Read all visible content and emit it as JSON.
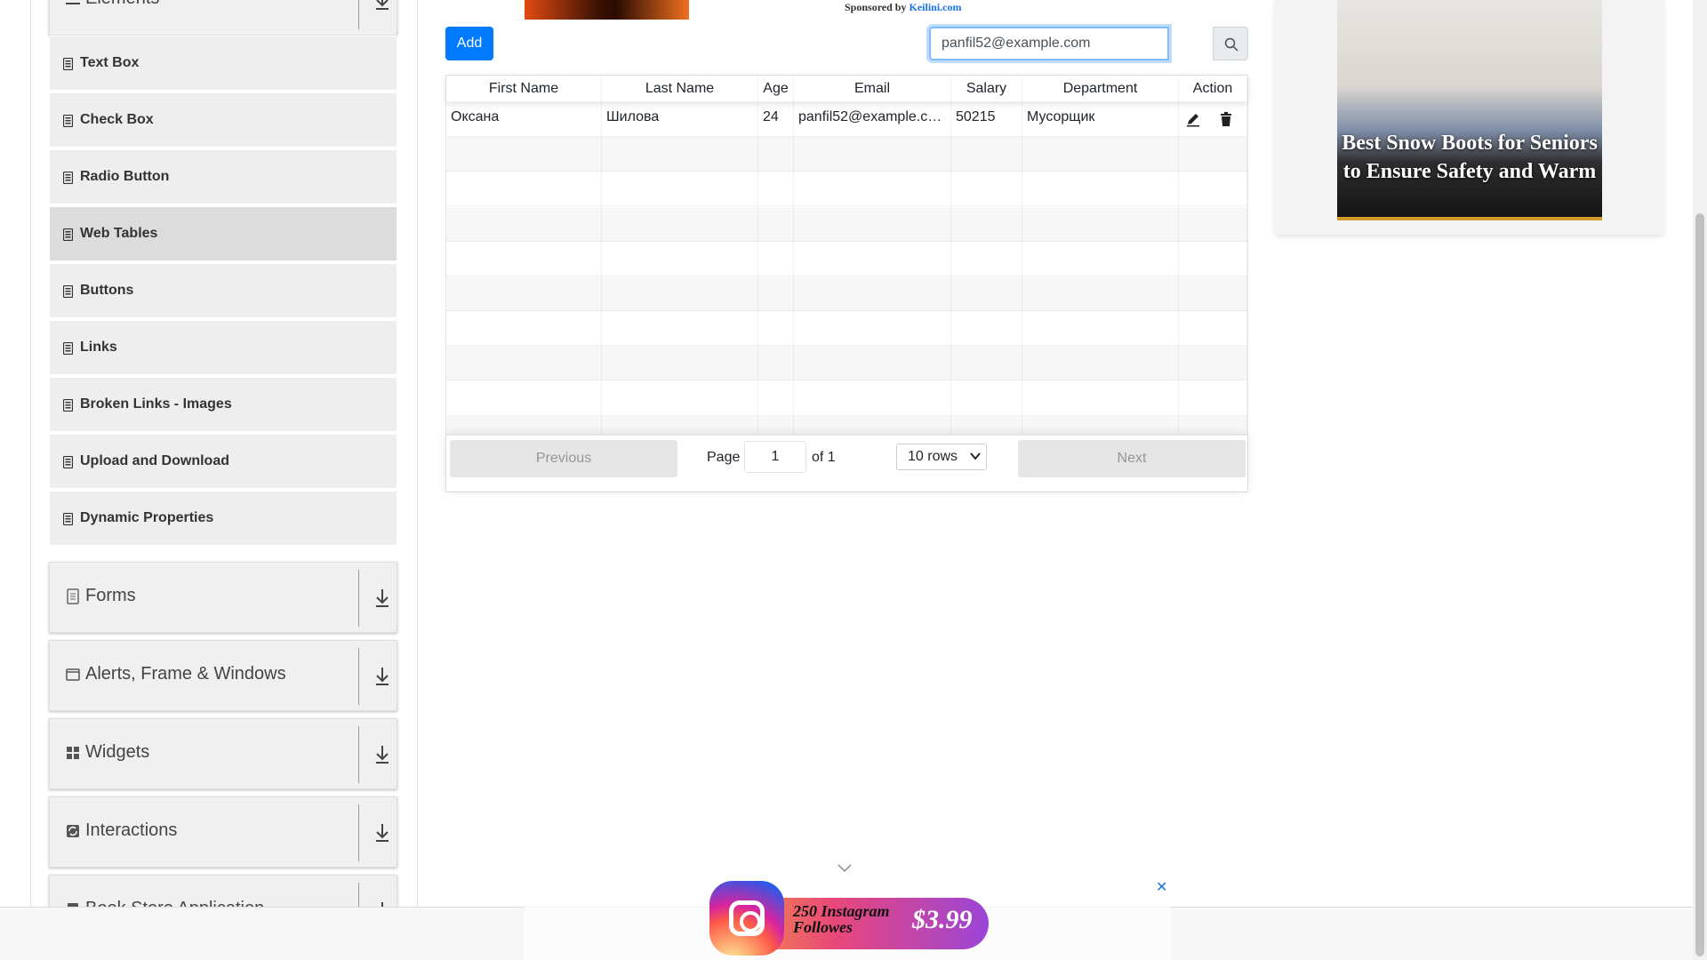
{
  "sidebar": {
    "elements_header": "Elements",
    "items": [
      {
        "label": "Text Box"
      },
      {
        "label": "Check Box"
      },
      {
        "label": "Radio Button"
      },
      {
        "label": "Web Tables"
      },
      {
        "label": "Buttons"
      },
      {
        "label": "Links"
      },
      {
        "label": "Broken Links - Images"
      },
      {
        "label": "Upload and Download"
      },
      {
        "label": "Dynamic Properties"
      }
    ],
    "active_item": "Web Tables",
    "groups": [
      {
        "label": "Forms",
        "icon": "document-icon"
      },
      {
        "label": "Alerts, Frame & Windows",
        "icon": "window-icon"
      },
      {
        "label": "Widgets",
        "icon": "grid-icon"
      },
      {
        "label": "Interactions",
        "icon": "sync-icon"
      },
      {
        "label": "Book Store Application",
        "icon": "book-icon"
      }
    ]
  },
  "toolbar": {
    "add_label": "Add",
    "search_value": "panfil52@example.com"
  },
  "sponsored": {
    "prefix": "Sponsored by",
    "link": "Keilini.com"
  },
  "table": {
    "columns": [
      "First Name",
      "Last Name",
      "Age",
      "Email",
      "Salary",
      "Department",
      "Action"
    ],
    "rows": [
      {
        "first": "Оксана",
        "last": "Шилова",
        "age": "24",
        "email": "panfil52@example.c…",
        "salary": "50215",
        "department": "Мусорщик"
      }
    ]
  },
  "pagination": {
    "previous": "Previous",
    "page_label": "Page",
    "page_value": "1",
    "of_label": "of 1",
    "rows_select": "10 rows",
    "next": "Next"
  },
  "right_ad": {
    "title": "Best Snow Boots for Seniors to Ensure Safety and Warm"
  },
  "bottom_ad": {
    "close": "✕",
    "text_line1": "250 Instagram",
    "text_line2": "Followes",
    "price": "$3.99"
  },
  "colors": {
    "primary": "#007bff",
    "sidebar_bg": "#eeeeee"
  }
}
